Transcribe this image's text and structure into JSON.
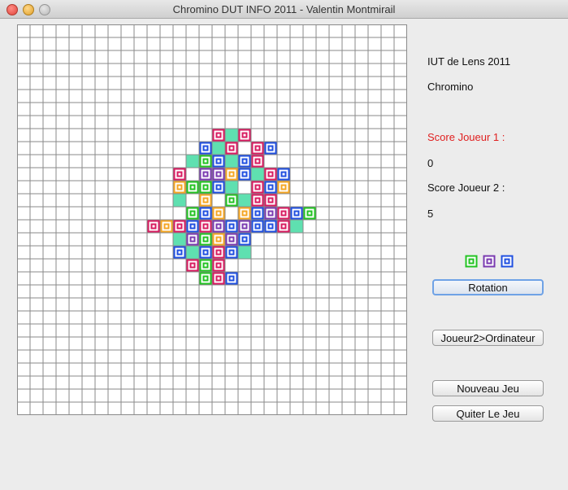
{
  "window": {
    "title": "Chromino DUT INFO 2011 - Valentin Montmirail"
  },
  "colors": {
    "score_label": "#e02020",
    "rotation_focus": "#6fa2e6"
  },
  "sidebar": {
    "school": "IUT de Lens 2011",
    "game": "Chromino",
    "score1_label": "Score Joueur 1 :",
    "score1_value": "0",
    "score2_label": "Score Joueur 2 :",
    "score2_value": "5"
  },
  "buttons": {
    "rotation": "Rotation",
    "switch_player": "Joueur2>Ordinateur",
    "new_game": "Nouveau Jeu",
    "quit": "Quiter Le Jeu"
  },
  "board": {
    "rows": 30,
    "cols": 30,
    "palette": {
      "R": "#d81b60",
      "G": "#22c322",
      "B": "#1f4fe0",
      "Y": "#f5a623",
      "P": "#7a3ab0",
      "J": "#5fe0b0"
    },
    "placed": [
      [
        8,
        15,
        "R"
      ],
      [
        8,
        16,
        "J"
      ],
      [
        8,
        17,
        "R"
      ],
      [
        9,
        14,
        "B"
      ],
      [
        9,
        15,
        "J"
      ],
      [
        9,
        16,
        "R"
      ],
      [
        9,
        18,
        "R"
      ],
      [
        9,
        19,
        "B"
      ],
      [
        10,
        13,
        "J"
      ],
      [
        10,
        14,
        "G"
      ],
      [
        10,
        15,
        "B"
      ],
      [
        10,
        16,
        "J"
      ],
      [
        10,
        17,
        "B"
      ],
      [
        10,
        18,
        "R"
      ],
      [
        11,
        12,
        "R"
      ],
      [
        11,
        14,
        "P"
      ],
      [
        11,
        15,
        "P"
      ],
      [
        11,
        16,
        "Y"
      ],
      [
        11,
        17,
        "B"
      ],
      [
        11,
        18,
        "J"
      ],
      [
        11,
        19,
        "R"
      ],
      [
        11,
        20,
        "B"
      ],
      [
        12,
        12,
        "Y"
      ],
      [
        12,
        13,
        "G"
      ],
      [
        12,
        14,
        "G"
      ],
      [
        12,
        15,
        "B"
      ],
      [
        12,
        16,
        "J"
      ],
      [
        12,
        18,
        "R"
      ],
      [
        12,
        19,
        "B"
      ],
      [
        12,
        20,
        "Y"
      ],
      [
        13,
        12,
        "J"
      ],
      [
        13,
        14,
        "Y"
      ],
      [
        13,
        16,
        "G"
      ],
      [
        13,
        17,
        "J"
      ],
      [
        13,
        18,
        "R"
      ],
      [
        13,
        19,
        "R"
      ],
      [
        14,
        13,
        "G"
      ],
      [
        14,
        14,
        "B"
      ],
      [
        14,
        15,
        "Y"
      ],
      [
        14,
        17,
        "Y"
      ],
      [
        14,
        18,
        "B"
      ],
      [
        14,
        19,
        "P"
      ],
      [
        14,
        20,
        "R"
      ],
      [
        14,
        21,
        "B"
      ],
      [
        14,
        22,
        "G"
      ],
      [
        15,
        10,
        "R"
      ],
      [
        15,
        11,
        "Y"
      ],
      [
        15,
        12,
        "R"
      ],
      [
        15,
        13,
        "B"
      ],
      [
        15,
        14,
        "R"
      ],
      [
        15,
        15,
        "P"
      ],
      [
        15,
        16,
        "B"
      ],
      [
        15,
        17,
        "P"
      ],
      [
        15,
        18,
        "B"
      ],
      [
        15,
        19,
        "B"
      ],
      [
        15,
        20,
        "R"
      ],
      [
        15,
        21,
        "J"
      ],
      [
        16,
        12,
        "J"
      ],
      [
        16,
        13,
        "P"
      ],
      [
        16,
        14,
        "G"
      ],
      [
        16,
        15,
        "Y"
      ],
      [
        16,
        16,
        "P"
      ],
      [
        16,
        17,
        "B"
      ],
      [
        17,
        12,
        "B"
      ],
      [
        17,
        13,
        "J"
      ],
      [
        17,
        14,
        "B"
      ],
      [
        17,
        15,
        "R"
      ],
      [
        17,
        16,
        "B"
      ],
      [
        17,
        17,
        "J"
      ],
      [
        18,
        13,
        "R"
      ],
      [
        18,
        14,
        "G"
      ],
      [
        18,
        15,
        "R"
      ],
      [
        19,
        14,
        "G"
      ],
      [
        19,
        15,
        "R"
      ],
      [
        19,
        16,
        "B"
      ]
    ]
  },
  "preview_tiles": [
    "G",
    "P",
    "B"
  ]
}
